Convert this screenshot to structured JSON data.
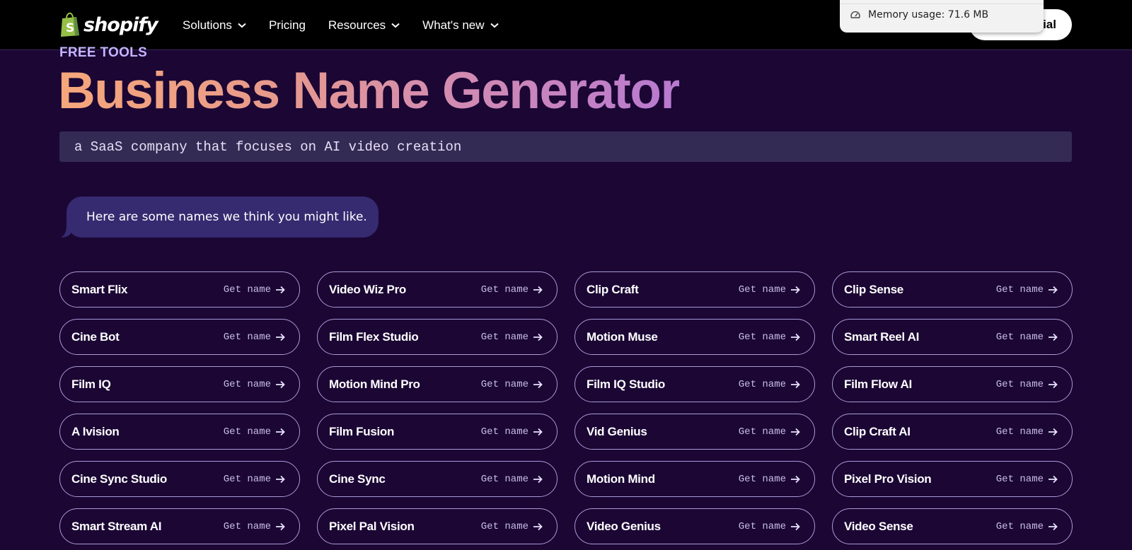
{
  "nav": {
    "brand": "shopify",
    "links": [
      {
        "label": "Solutions",
        "has_dropdown": true
      },
      {
        "label": "Pricing",
        "has_dropdown": false
      },
      {
        "label": "Resources",
        "has_dropdown": true
      },
      {
        "label": "What's new",
        "has_dropdown": true
      }
    ],
    "cta_label_visible": "rial"
  },
  "memory_popup": {
    "icon": "gauge-icon",
    "text": "Memory usage: 71.6 MB"
  },
  "hero": {
    "eyebrow": "FREE TOOLS",
    "title": "Business Name Generator",
    "prompt": "a SaaS company that focuses on AI video creation"
  },
  "results": {
    "intro": "Here are some names we think you might like.",
    "action_label": "Get name",
    "names": [
      "Smart Flix",
      "Video Wiz Pro",
      "Clip Craft",
      "Clip Sense",
      "Cine Bot",
      "Film Flex Studio",
      "Motion Muse",
      "Smart Reel AI",
      "Film IQ",
      "Motion Mind Pro",
      "Film IQ Studio",
      "Film Flow AI",
      "A Ivision",
      "Film Fusion",
      "Vid Genius",
      "Clip Craft AI",
      "Cine Sync Studio",
      "Cine Sync",
      "Motion Mind",
      "Pixel Pro Vision",
      "Smart Stream AI",
      "Pixel Pal Vision",
      "Video Genius",
      "Video Sense"
    ]
  },
  "colors": {
    "background": "#1b0634",
    "nav_bg": "#000000",
    "brand_green": "#95bf47",
    "chip_border": "#a99bd6",
    "bubble_bg": "#362a70",
    "prompt_bg": "#342b55"
  }
}
